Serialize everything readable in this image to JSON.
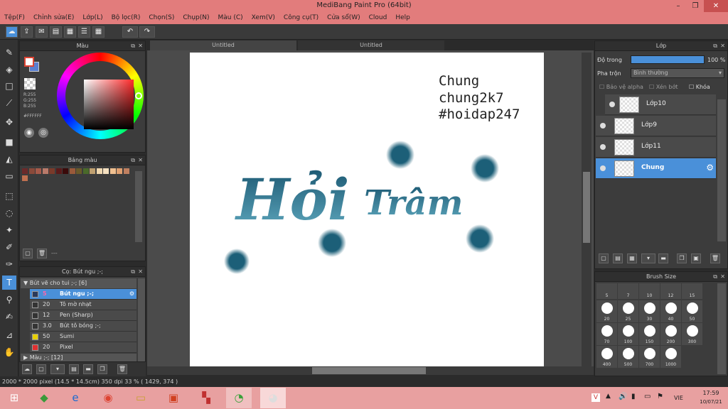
{
  "window": {
    "title": "MediBang Paint Pro (64bit)",
    "min": "–",
    "max": "❐",
    "close": "✕"
  },
  "menu": [
    "Tệp(F)",
    "Chỉnh sửa(E)",
    "Lớp(L)",
    "Bộ lọc(R)",
    "Chọn(S)",
    "Chụp(N)",
    "Màu (C)",
    "Xem(V)",
    "Công cụ(T)",
    "Cửa sổ(W)",
    "Cloud",
    "Help"
  ],
  "color_panel": {
    "title": "Màu",
    "r": "R:255",
    "g": "G:255",
    "b": "B:255",
    "hex": "#FFFFFF"
  },
  "palette_panel": {
    "title": "Bảng màu",
    "colors": [
      "#6b2a2a",
      "#8a4a3a",
      "#a65a4a",
      "#b97a6a",
      "#7a3a2a",
      "#5a1a1a",
      "#3a0a0a",
      "#9a5a3a",
      "#6a5a2a",
      "#4a6a2a",
      "#c0a070",
      "#f0d8b0",
      "#f5e0c0",
      "#f0c090",
      "#e0a070",
      "#c08060"
    ],
    "extra": "#c07050",
    "footer_text": "---"
  },
  "brush_panel": {
    "title": "Cọ: Bút ngu ;-;",
    "group1": "Bút vẽ cho tui ;-; [6]",
    "group2": "Màu ;-; [12]",
    "items": [
      {
        "size": "5",
        "name": "Bút ngu ;-;",
        "color": "#2a3a5a"
      },
      {
        "size": "20",
        "name": "Tô mờ nhạt",
        "color": "#333333"
      },
      {
        "size": "12",
        "name": "Pen (Sharp)",
        "color": "#333333"
      },
      {
        "size": "3.0",
        "name": "Bút tô bóng ;-;",
        "color": "#333333"
      },
      {
        "size": "50",
        "name": "Sumi",
        "color": "#e8d000"
      },
      {
        "size": "20",
        "name": "Pixel",
        "color": "#e03030"
      }
    ]
  },
  "tabs": [
    "Untitled",
    "Untitled"
  ],
  "artwork": {
    "caption_line1": "Chung",
    "caption_line2": "chung2k7",
    "caption_line3": "#hoidap247",
    "word1": "Hỏi",
    "word2": "Trâm"
  },
  "layer_panel": {
    "title": "Lớp",
    "opacity_label": "Độ trong",
    "opacity_value": "100 %",
    "blend_label": "Pha trộn",
    "blend_value": "Bình thường",
    "protect_alpha": "Bảo vệ alpha",
    "clipping": "Xén bớt",
    "lock": "Khóa",
    "layers": [
      "Lớp10",
      "Lớp9",
      "Lớp11",
      "Chung"
    ]
  },
  "brush_size_panel": {
    "title": "Brush Size",
    "row0": [
      "5",
      "7",
      "10",
      "12",
      "15"
    ],
    "sizes": [
      "20",
      "25",
      "30",
      "40",
      "50",
      "70",
      "100",
      "150",
      "200",
      "300",
      "400",
      "500",
      "700",
      "1000"
    ]
  },
  "status": {
    "text": "2000 * 2000 pixel   (14.5 * 14.5cm)   350 dpi   33 %   ( 1429, 374 )"
  },
  "taskbar": {
    "lang": "VIE",
    "time": "17:59",
    "date": "10/07/21"
  }
}
